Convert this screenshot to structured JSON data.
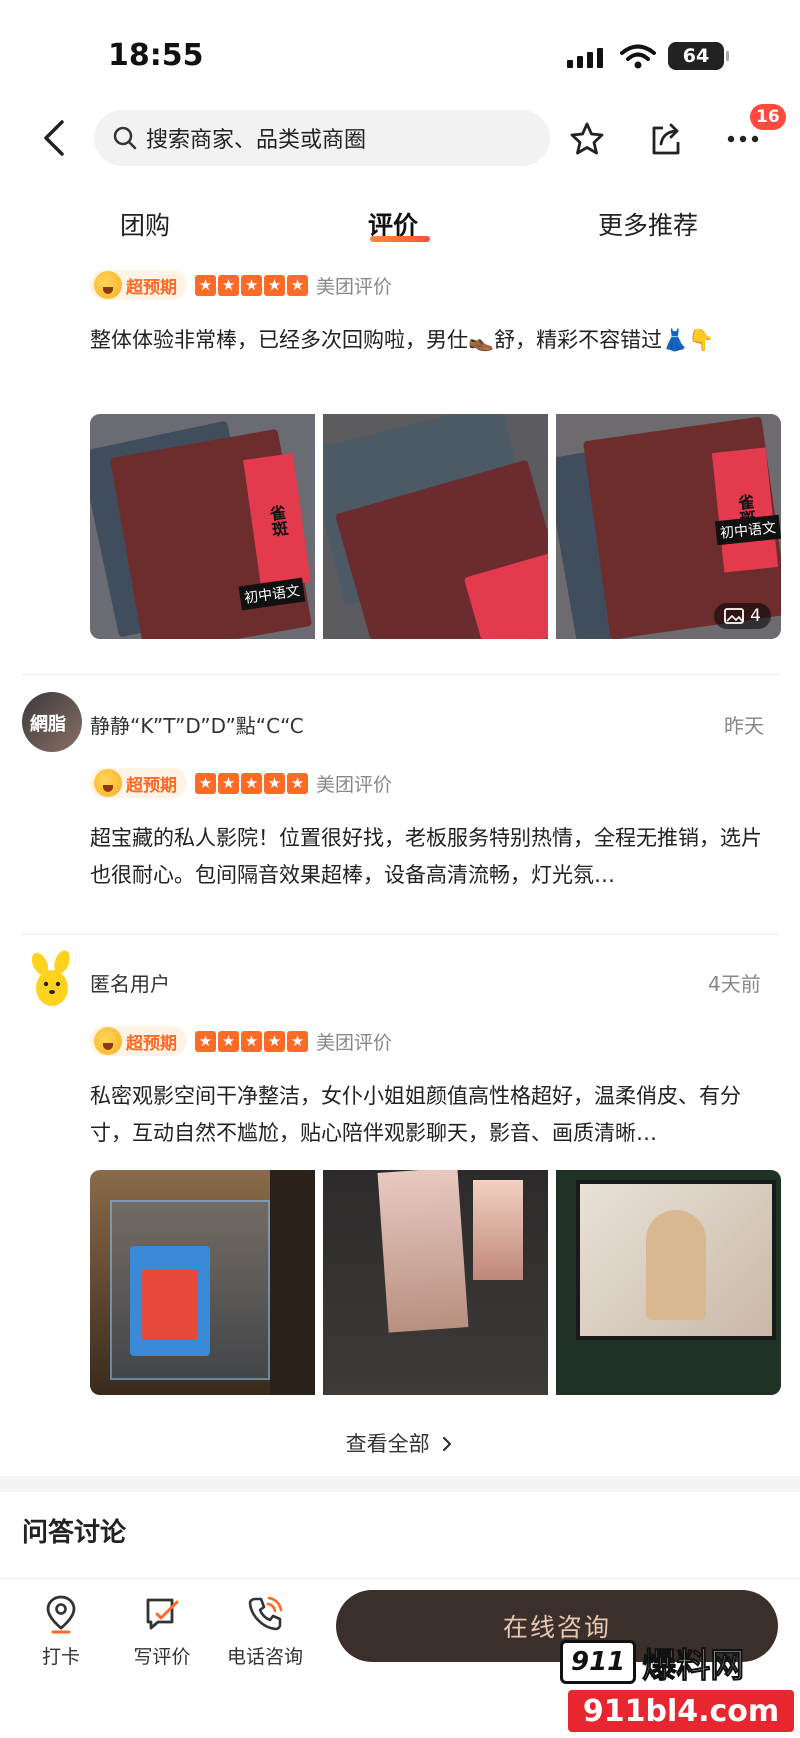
{
  "status_bar": {
    "time": "18:55",
    "battery": "64"
  },
  "header": {
    "search_placeholder": "搜索商家、品类或商圈",
    "notification_count": "16"
  },
  "tabs": [
    {
      "label": "团购",
      "active": false
    },
    {
      "label": "评价",
      "active": true
    },
    {
      "label": "更多推荐",
      "active": false
    }
  ],
  "reviews": [
    {
      "tag": "超预期",
      "source": "美团评价",
      "text": "整体体验非常棒，已经多次回购啦，男仕👞舒，精彩不容错过👗👇",
      "image_count": "4"
    },
    {
      "user": "静静“K”T”D”D”點“C“C",
      "avatar_text": "網脂",
      "time": "昨天",
      "tag": "超预期",
      "source": "美团评价",
      "text": "超宝藏的私人影院！位置很好找，老板服务特别热情，全程无推销，选片也很耐心。包间隔音效果超棒，设备高清流畅，灯光氛…"
    },
    {
      "user": "匿名用户",
      "time": "4天前",
      "tag": "超预期",
      "source": "美团评价",
      "text": "私密观影空间干净整洁，女仆小姐姐颜值高性格超好，温柔俏皮、有分寸，互动自然不尴尬，贴心陪伴观影聊天，影音、画质清晰…"
    }
  ],
  "book_labels": {
    "cover_title": "雀斑",
    "subject": "初中语文"
  },
  "view_all": "查看全部",
  "qa_title": "问答讨论",
  "bottom_bar": {
    "items": [
      {
        "label": "打卡",
        "icon": "location-pin-icon"
      },
      {
        "label": "写评价",
        "icon": "write-review-icon"
      },
      {
        "label": "电话咨询",
        "icon": "phone-icon"
      }
    ],
    "consult_label": "在线咨询"
  },
  "watermark": {
    "logo": "911",
    "name": "爆料网",
    "url": "911bl4.com"
  },
  "colors": {
    "accent": "#ff6a26",
    "consult_bg": "#3a2f2b",
    "badge": "#ff4a3d"
  }
}
